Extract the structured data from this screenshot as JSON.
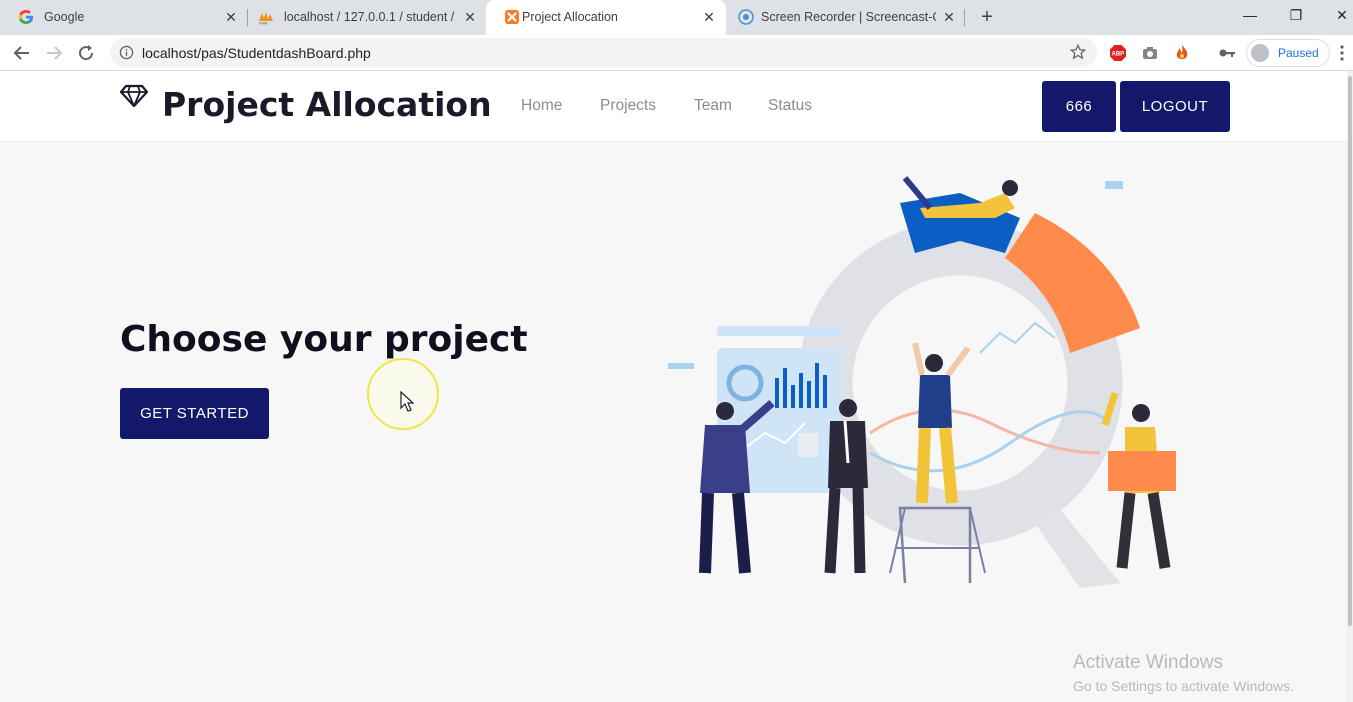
{
  "browser": {
    "tabs": [
      {
        "title": "Google",
        "icon": "google-icon"
      },
      {
        "title": "localhost / 127.0.0.1 / student / s",
        "icon": "phpmyadmin-icon"
      },
      {
        "title": "Project Allocation",
        "icon": "xampp-icon",
        "active": true
      },
      {
        "title": "Screen Recorder | Screencast-O-M",
        "icon": "screencast-icon"
      }
    ],
    "url": "localhost/pas/StudentdashBoard.php",
    "profile_label": "Paused",
    "extensions": [
      "abp-icon",
      "camera-icon",
      "fire-icon",
      "key-icon"
    ]
  },
  "site": {
    "brand": "Project Allocation",
    "nav": [
      "Home",
      "Projects",
      "Team",
      "Status"
    ],
    "user_button": "666",
    "logout_button": "LOGOUT"
  },
  "hero": {
    "title": "Choose your project",
    "cta": "GET STARTED"
  },
  "watermark": {
    "line1": "Activate Windows",
    "line2": "Go to Settings to activate Windows."
  },
  "colors": {
    "primary": "#14186a",
    "orange": "#ff8a4c",
    "blue": "#0b5fc4"
  }
}
